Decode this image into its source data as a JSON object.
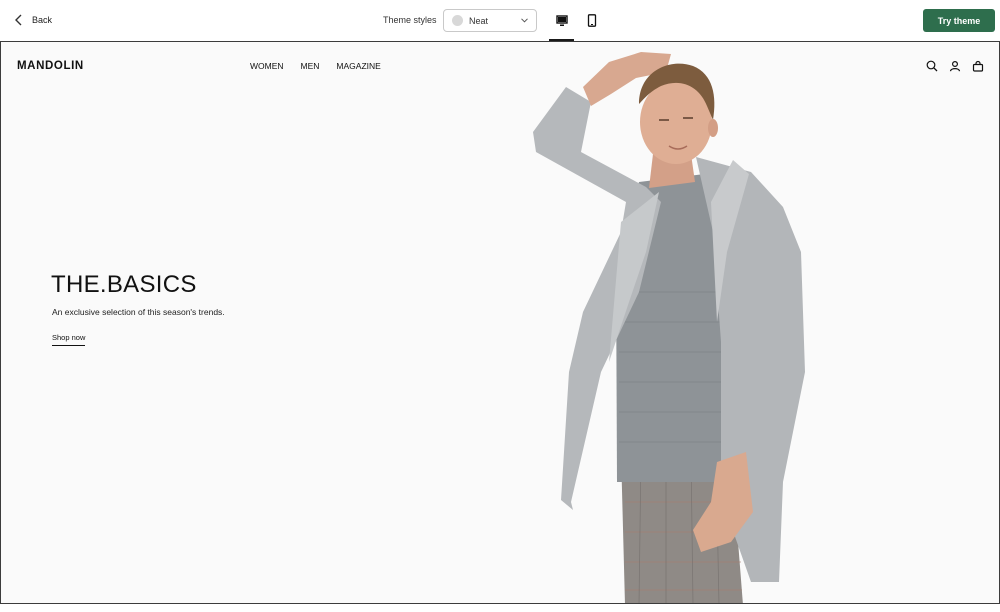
{
  "editor": {
    "back_label": "Back",
    "styles_label": "Theme styles",
    "style_selected": "Neat",
    "try_label": "Try theme",
    "active_device": "desktop",
    "accent_color": "#2e6e4d"
  },
  "store": {
    "logo": "MANDOLIN",
    "nav": [
      "WOMEN",
      "MEN",
      "MAGAZINE"
    ],
    "icons": [
      "search-icon",
      "account-icon",
      "cart-icon"
    ]
  },
  "hero": {
    "title": "THE.BASICS",
    "subtitle": "An exclusive selection of this season's trends.",
    "link": "Shop now"
  }
}
